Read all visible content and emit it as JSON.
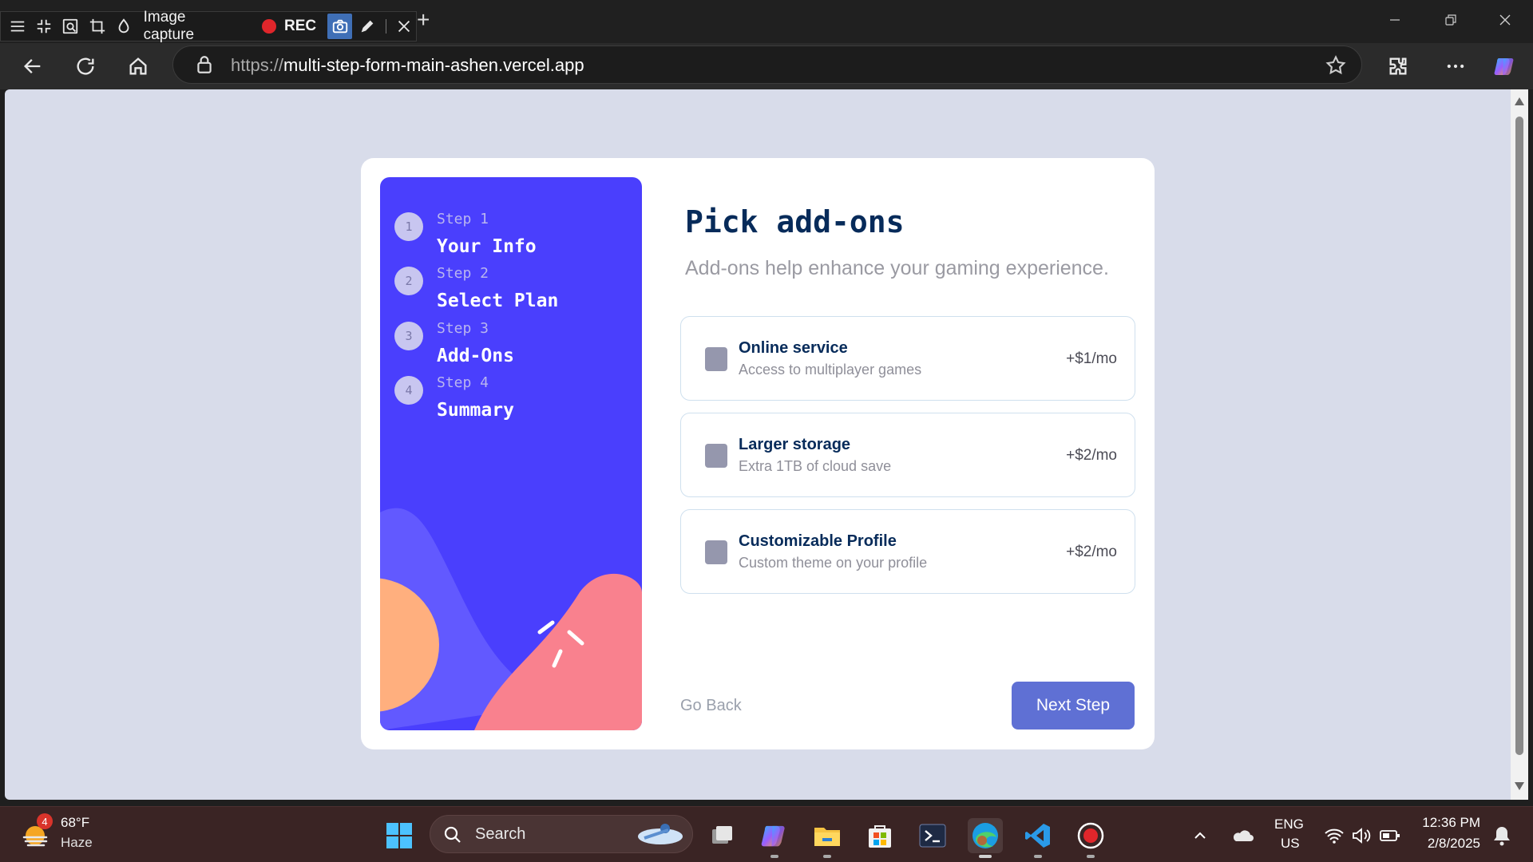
{
  "capture_toolbar": {
    "label": "Image capture",
    "rec_label": "REC"
  },
  "browser": {
    "url_scheme": "https://",
    "url_host": "multi-step-form-main-ashen.vercel.app"
  },
  "sidebar": {
    "steps": [
      {
        "number": "1",
        "label": "Step 1",
        "title": "Your Info"
      },
      {
        "number": "2",
        "label": "Step 2",
        "title": "Select Plan"
      },
      {
        "number": "3",
        "label": "Step 3",
        "title": "Add-Ons"
      },
      {
        "number": "4",
        "label": "Step 4",
        "title": "Summary"
      }
    ]
  },
  "main": {
    "title": "Pick add-ons",
    "subtitle": "Add-ons help enhance your gaming experience.",
    "addons": [
      {
        "name": "Online service",
        "description": "Access to multiplayer games",
        "price": "+$1/mo",
        "checked": false
      },
      {
        "name": "Larger storage",
        "description": "Extra 1TB of cloud save",
        "price": "+$2/mo",
        "checked": false
      },
      {
        "name": "Customizable Profile",
        "description": "Custom theme on your profile",
        "price": "+$2/mo",
        "checked": false
      }
    ],
    "back_label": "Go Back",
    "next_label": "Next Step"
  },
  "colors": {
    "sidebar_bg": "#4a3ffd",
    "title": "#072b5a",
    "next_button": "#5f70d4",
    "page_bg": "#d8dcea"
  },
  "taskbar": {
    "weather_temp": "68°F",
    "weather_desc": "Haze",
    "weather_badge": "4",
    "search_label": "Search",
    "lang_top": "ENG",
    "lang_bottom": "US",
    "time": "12:36 PM",
    "date": "2/8/2025"
  }
}
